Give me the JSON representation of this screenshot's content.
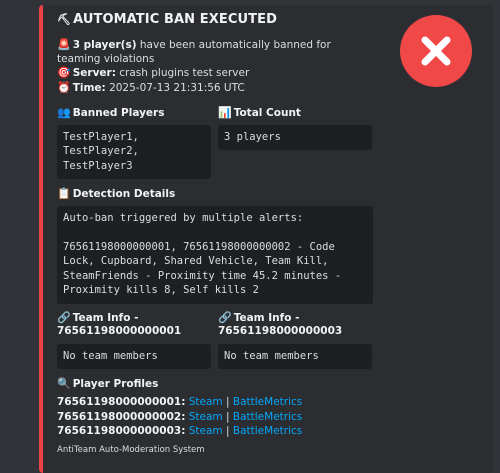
{
  "embed": {
    "title": "AUTOMATIC BAN EXECUTED",
    "accent_color": "#ed4245",
    "description": {
      "count_bold": "3 player(s)",
      "count_rest": " have been automatically banned for teaming violations",
      "server_label": "Server:",
      "server_value": " crash plugins test server",
      "time_label": "Time:",
      "time_value": " 2025-07-13 21:31:56 UTC"
    },
    "fields": {
      "banned_players": {
        "name": "Banned Players",
        "value": "TestPlayer1,\nTestPlayer2,\nTestPlayer3"
      },
      "total_count": {
        "name": "Total Count",
        "value": "3 players"
      },
      "detection": {
        "name": "Detection Details",
        "value": "Auto-ban triggered by multiple alerts:\n\n76561198000000001, 76561198000000002 - Code Lock, Cupboard, Shared Vehicle, Team Kill, SteamFriends - Proximity time 45.2 minutes - Proximity kills 8, Self kills 2"
      },
      "team_info_1": {
        "name_line1": "Team Info -",
        "name_line2": "76561198000000001",
        "value": "No team members"
      },
      "team_info_3": {
        "name_line1": "Team Info -",
        "name_line2": "76561198000000003",
        "value": "No team members"
      },
      "profiles": {
        "name": "Player Profiles",
        "separator": "|",
        "entries": [
          {
            "id": "76561198000000001:",
            "steam": "Steam",
            "bm": "BattleMetrics"
          },
          {
            "id": "76561198000000002:",
            "steam": "Steam",
            "bm": "BattleMetrics"
          },
          {
            "id": "76561198000000003:",
            "steam": "Steam",
            "bm": "BattleMetrics"
          }
        ]
      }
    },
    "footer": "AntiTeam Auto-Moderation System",
    "thumbnail": {
      "icon": "red-x-circle-icon",
      "color": "#f04747"
    }
  }
}
